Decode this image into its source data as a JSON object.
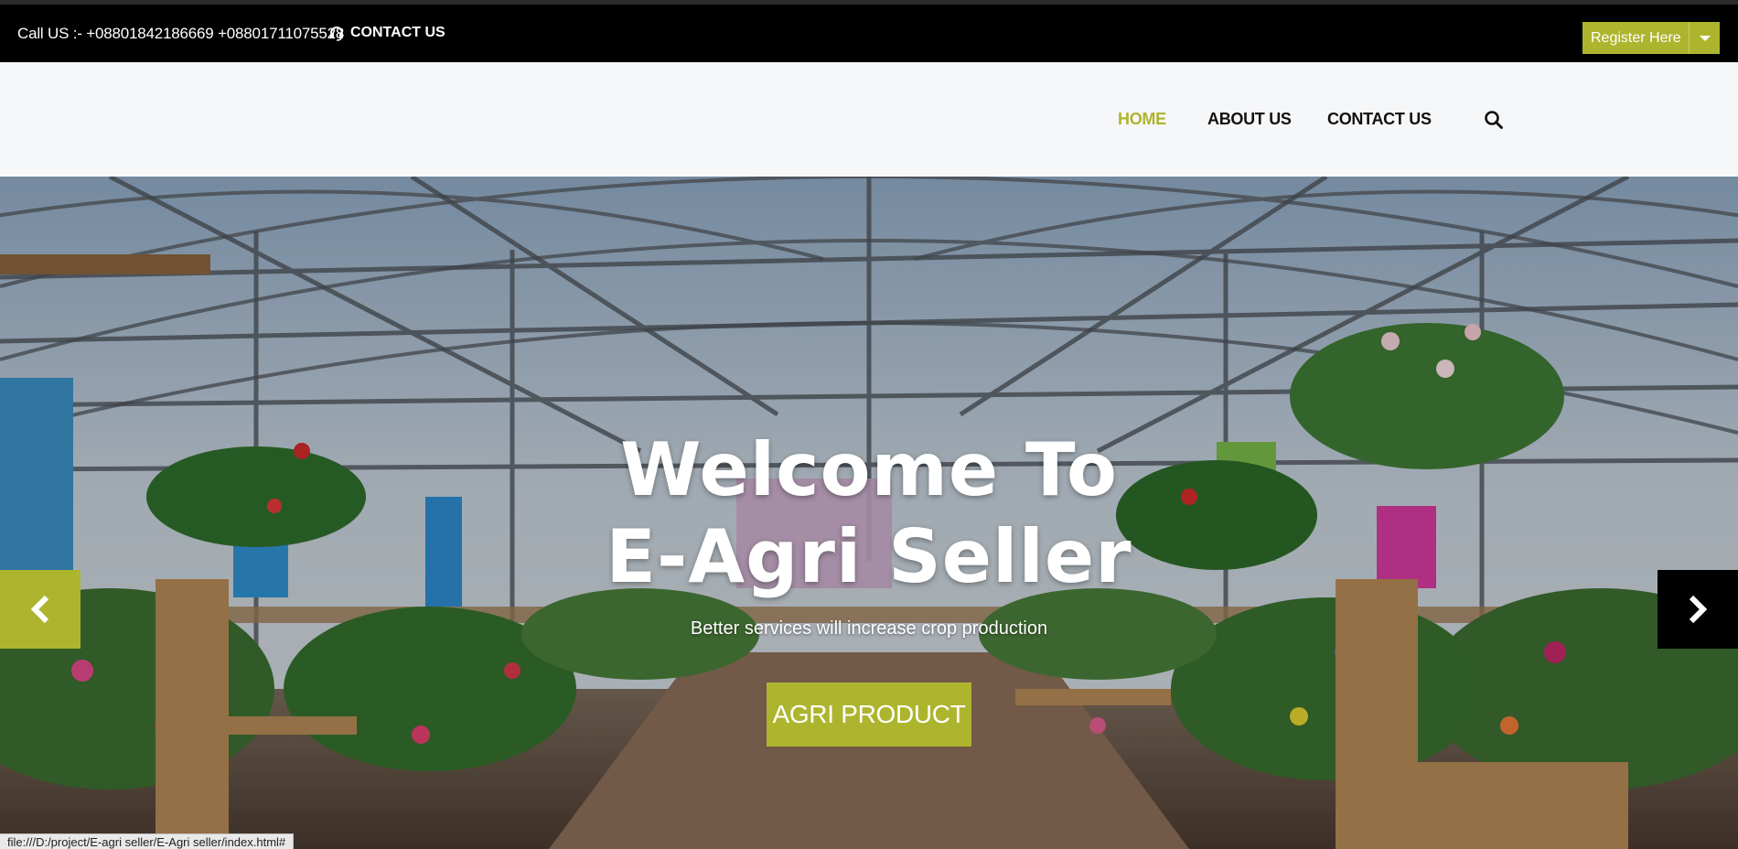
{
  "topbar": {
    "call_text": "Call US :- +08801842186669 +08801711075528",
    "contact_label": "CONTACT US",
    "contact_icon": "headset-icon",
    "register_label": "Register Here"
  },
  "nav": {
    "items": [
      {
        "label": "HOME",
        "active": true
      },
      {
        "label": "ABOUT US",
        "active": false
      },
      {
        "label": "CONTACT US",
        "active": false
      }
    ],
    "search_icon": "search-icon"
  },
  "hero": {
    "title_line1": "Welcome To",
    "title_line2": "E-Agri Seller",
    "subtitle": "Better services will increase crop production",
    "cta_label": "AGRI PRODUCT",
    "prev_icon": "chevron-left-icon",
    "next_icon": "chevron-right-icon"
  },
  "status_bar": {
    "url": "file:///D:/project/E-agri seller/E-Agri seller/index.html#"
  },
  "colors": {
    "accent": "#adb52e",
    "topbar_bg": "#000000",
    "navbar_bg": "#f6f7f9"
  }
}
